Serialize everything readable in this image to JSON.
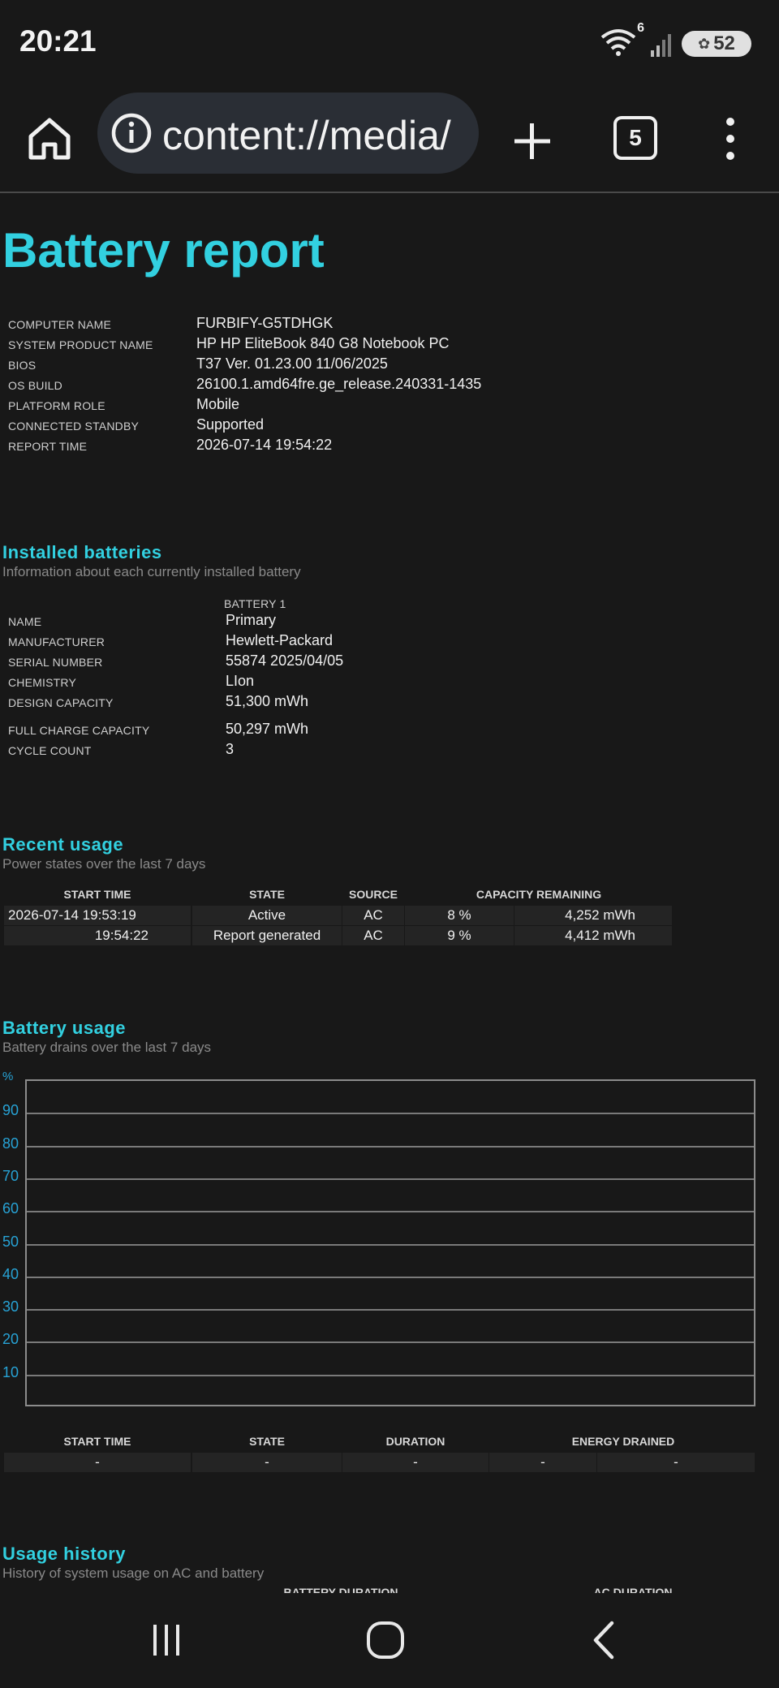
{
  "status_bar": {
    "time": "20:21",
    "wifi_badge": "6",
    "battery_level": "52",
    "icons": [
      "wifi-icon",
      "signal-icon",
      "battery-saver-icon"
    ]
  },
  "browser": {
    "url": "content://media/",
    "tab_count": "5",
    "icons": [
      "home-icon",
      "info-icon",
      "plus-icon",
      "tabs-icon",
      "menu-icon"
    ]
  },
  "report": {
    "title": "Battery report",
    "system_info": [
      {
        "key": "COMPUTER NAME",
        "value": "FURBIFY-G5TDHGK"
      },
      {
        "key": "SYSTEM PRODUCT NAME",
        "value": "HP HP EliteBook 840 G8 Notebook PC"
      },
      {
        "key": "BIOS",
        "value": "T37 Ver. 01.23.00 11/06/2025"
      },
      {
        "key": "OS BUILD",
        "value": "26100.1.amd64fre.ge_release.240331-1435"
      },
      {
        "key": "PLATFORM ROLE",
        "value": "Mobile"
      },
      {
        "key": "CONNECTED STANDBY",
        "value": "Supported"
      },
      {
        "key": "REPORT TIME",
        "value": "2026-07-14  19:54:22"
      }
    ]
  },
  "installed_batteries": {
    "title": "Installed batteries",
    "subtitle": "Information about each currently installed battery",
    "column_header": "BATTERY 1",
    "rows": [
      {
        "key": "NAME",
        "value": "Primary"
      },
      {
        "key": "MANUFACTURER",
        "value": "Hewlett-Packard"
      },
      {
        "key": "SERIAL NUMBER",
        "value": "55874 2025/04/05"
      },
      {
        "key": "CHEMISTRY",
        "value": "LIon"
      },
      {
        "key": "DESIGN CAPACITY",
        "value": "51,300 mWh"
      },
      {
        "key": "FULL CHARGE CAPACITY",
        "value": "50,297 mWh"
      },
      {
        "key": "CYCLE COUNT",
        "value": "3"
      }
    ]
  },
  "recent_usage": {
    "title": "Recent usage",
    "subtitle": "Power states over the last 7 days",
    "headers": [
      "START TIME",
      "STATE",
      "SOURCE",
      "CAPACITY REMAINING"
    ],
    "rows": [
      {
        "start": "2026-07-14  19:53:19",
        "state": "Active",
        "source": "AC",
        "percent": "8 %",
        "mwh": "4,252 mWh"
      },
      {
        "start": "19:54:22",
        "state": "Report generated",
        "source": "AC",
        "percent": "9 %",
        "mwh": "4,412 mWh"
      }
    ]
  },
  "battery_usage": {
    "title": "Battery usage",
    "subtitle": "Battery drains over the last 7 days",
    "headers": [
      "START TIME",
      "STATE",
      "DURATION",
      "ENERGY DRAINED"
    ],
    "row": [
      "-",
      "-",
      "-",
      "-",
      "-"
    ]
  },
  "chart_data": {
    "type": "line",
    "title": "",
    "xlabel": "",
    "ylabel": "%",
    "ylim": [
      0,
      100
    ],
    "yticks": [
      "90",
      "80",
      "70",
      "60",
      "50",
      "40",
      "30",
      "20",
      "10"
    ],
    "grid": true,
    "series": []
  },
  "usage_history": {
    "title": "Usage history",
    "subtitle": "History of system usage on AC and battery",
    "headers": [
      "BATTERY DURATION",
      "AC DURATION"
    ]
  }
}
